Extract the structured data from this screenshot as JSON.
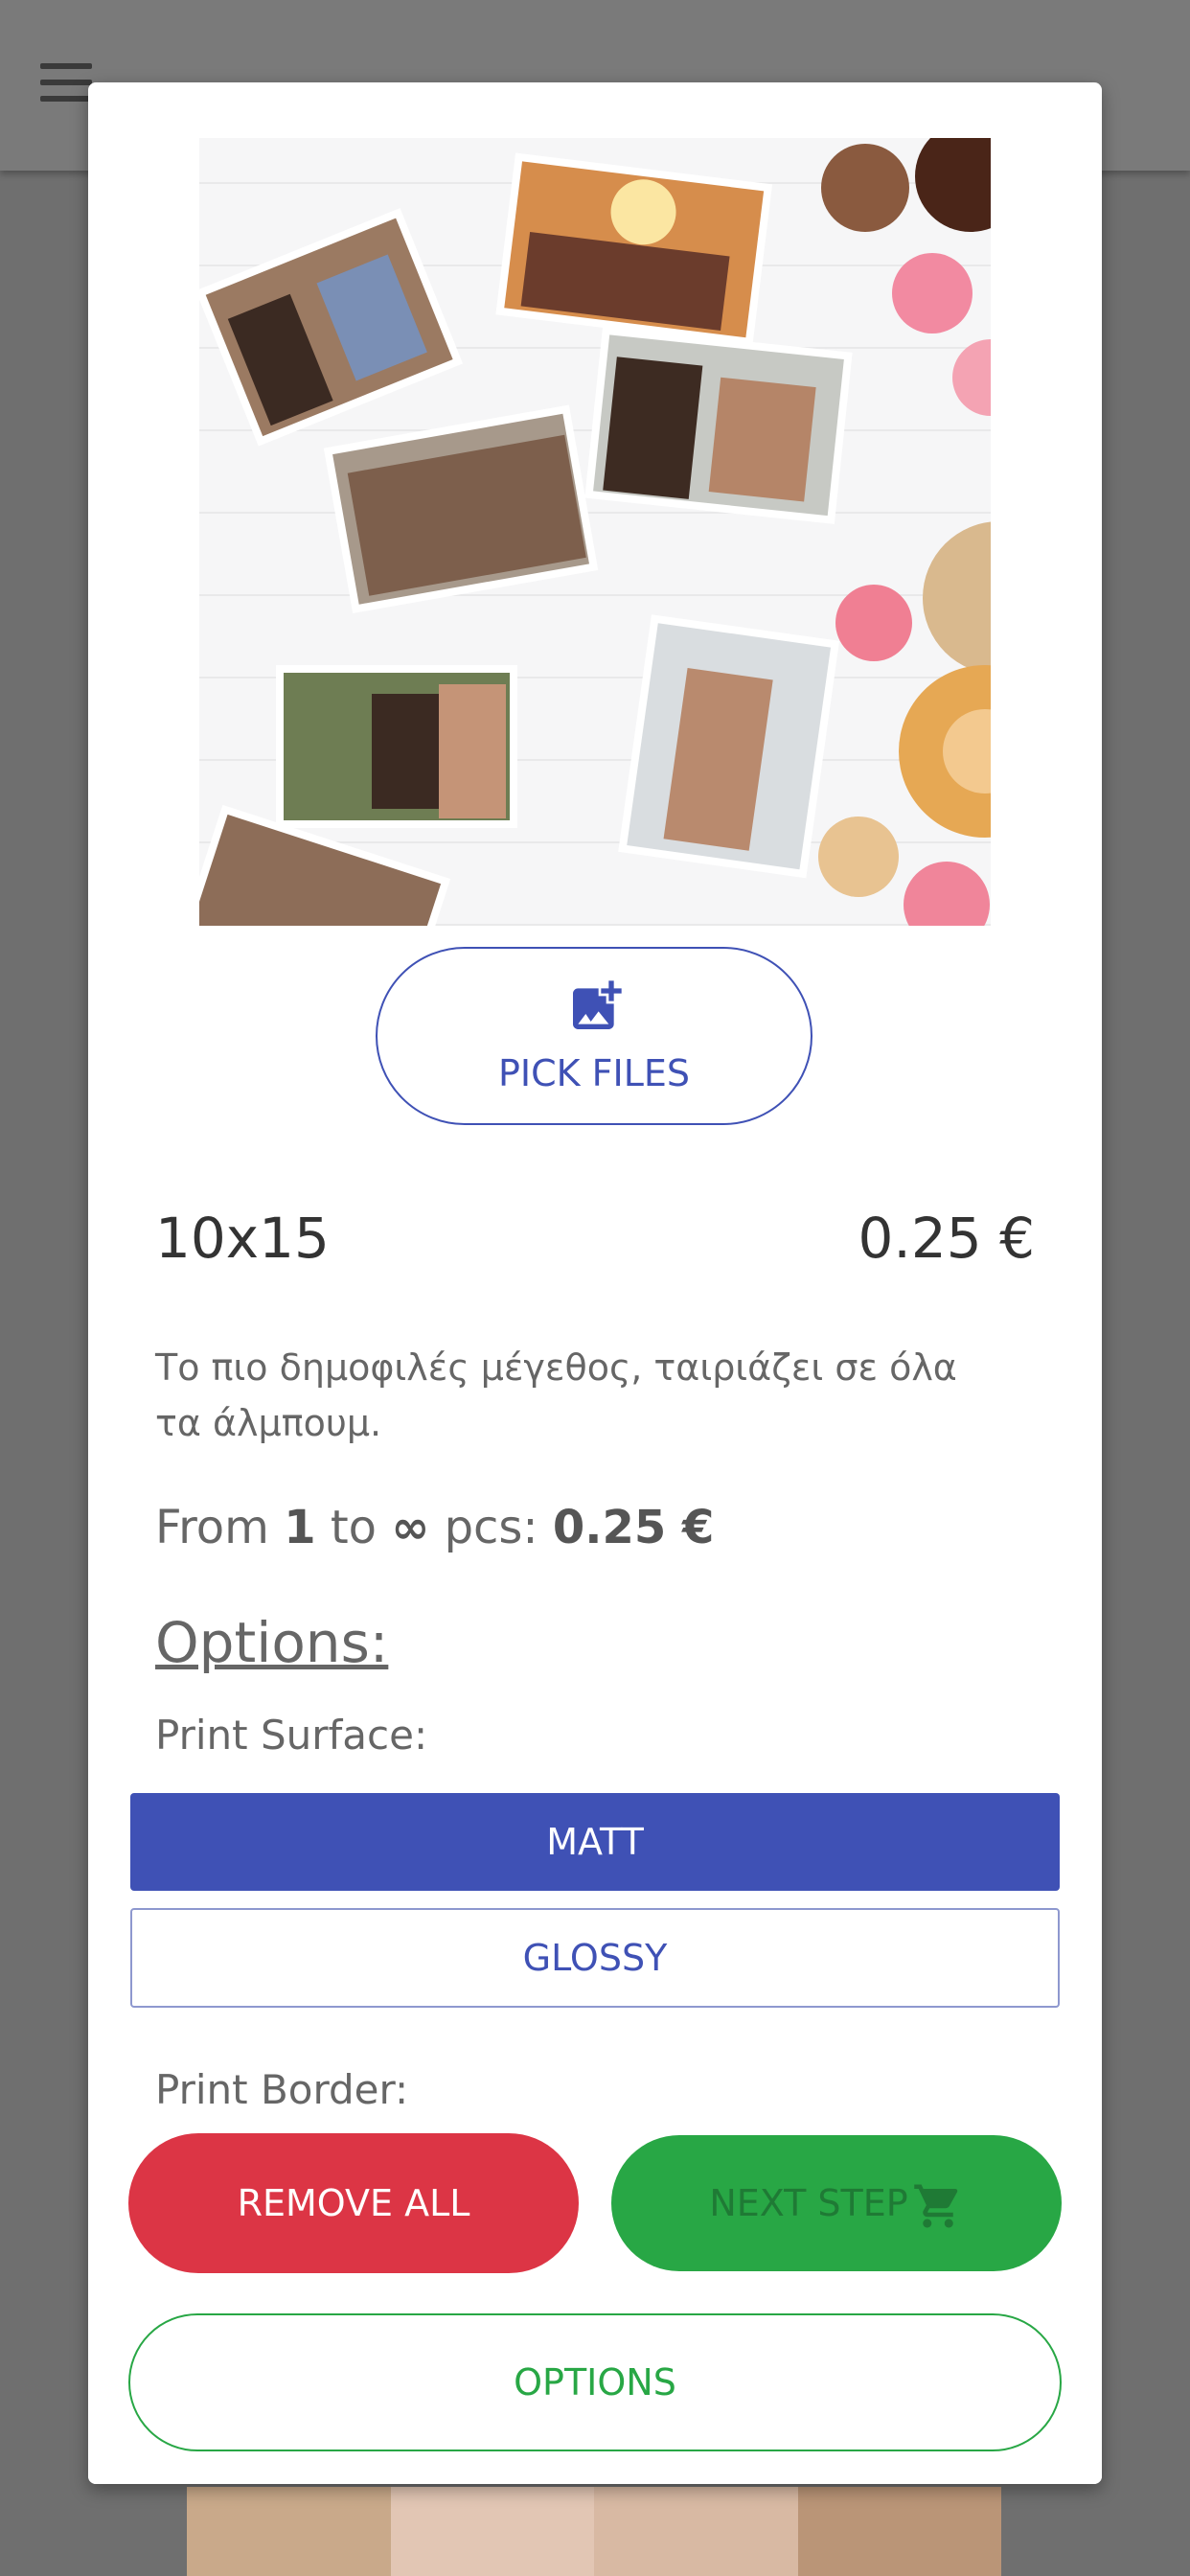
{
  "product": {
    "size": "10x15",
    "price": "0.25 €",
    "description": "Το πιο δημοφιλές μέγεθος, ταιριάζει σε όλα τα άλμπουμ.",
    "tier": {
      "from_label": "From",
      "from": "1",
      "to_label": "to",
      "to": "∞",
      "unit": "pcs:",
      "price": "0.25 €"
    }
  },
  "pick_files": {
    "label": "PICK FILES",
    "icon": "add-photo-icon"
  },
  "options": {
    "heading": "Options:",
    "print_surface_label": "Print Surface:",
    "surfaces": [
      {
        "label": "MATT",
        "selected": true
      },
      {
        "label": "GLOSSY",
        "selected": false
      }
    ],
    "print_border_label": "Print Border:"
  },
  "footer": {
    "remove_all": "REMOVE ALL",
    "next_step": "NEXT STEP",
    "next_step_icon": "cart-icon",
    "options": "OPTIONS"
  },
  "colors": {
    "primary": "#3f51b5",
    "danger": "#dc3545",
    "success": "#28a745"
  }
}
